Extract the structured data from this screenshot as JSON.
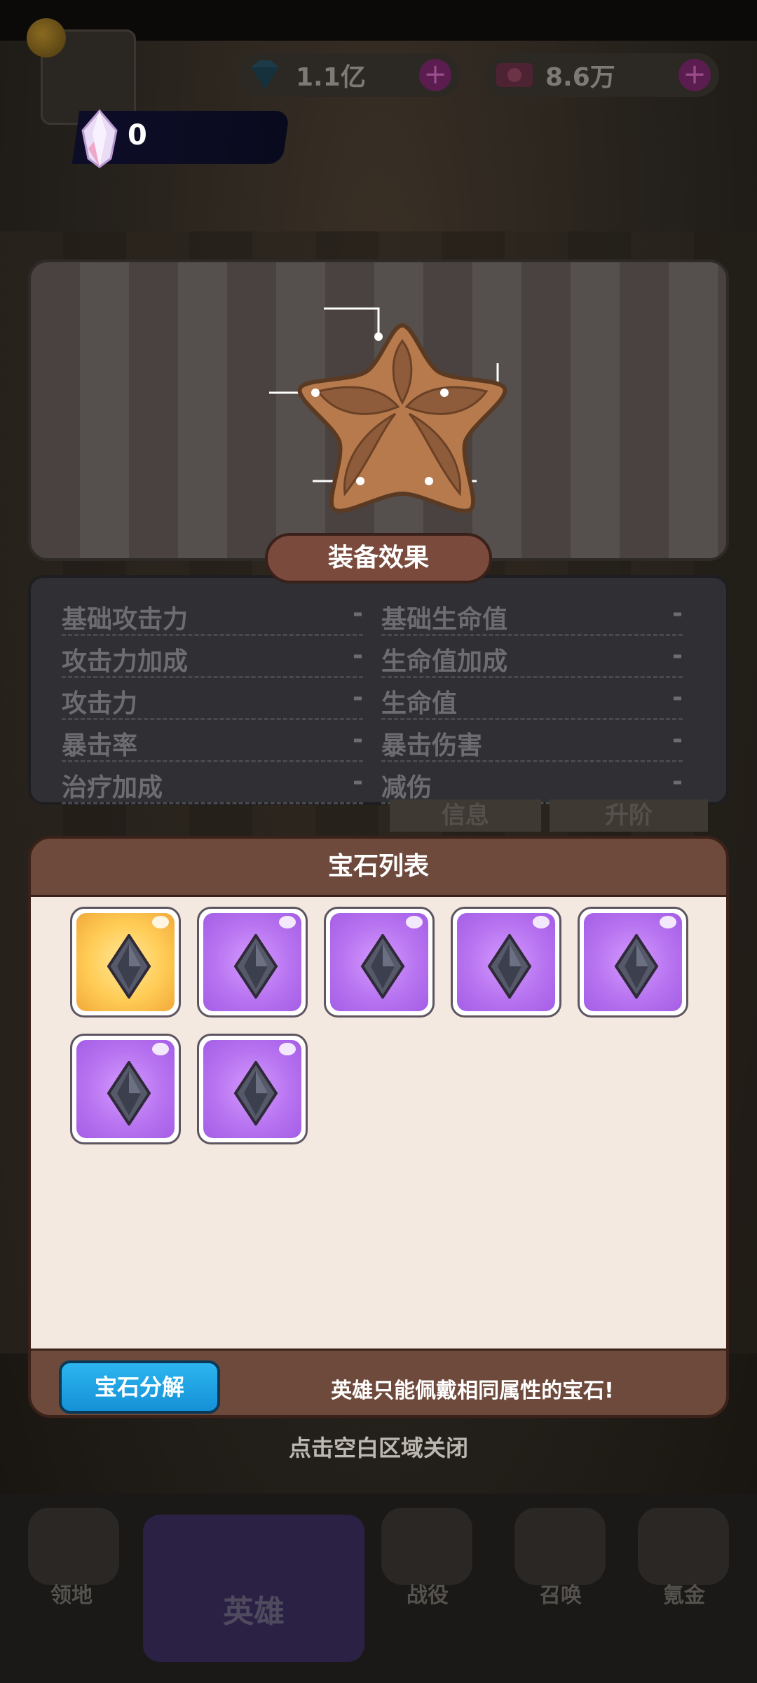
{
  "topbar": {
    "diamonds": "1.1亿",
    "coupons": "8.6万",
    "gem_currency": "0"
  },
  "equip_effect": {
    "title": "装备效果",
    "stats": [
      {
        "label": "基础攻击力",
        "value": "-"
      },
      {
        "label": "基础生命值",
        "value": "-"
      },
      {
        "label": "攻击力加成",
        "value": "-"
      },
      {
        "label": "生命值加成",
        "value": "-"
      },
      {
        "label": "攻击力",
        "value": "-"
      },
      {
        "label": "生命值",
        "value": "-"
      },
      {
        "label": "暴击率",
        "value": "-"
      },
      {
        "label": "暴击伤害",
        "value": "-"
      },
      {
        "label": "治疗加成",
        "value": "-"
      },
      {
        "label": "减伤",
        "value": "-"
      }
    ]
  },
  "background_tabs": {
    "info": "信息",
    "ascend": "升阶"
  },
  "gem_list": {
    "title": "宝石列表",
    "gems": [
      {
        "rarity": "gold",
        "color": "#ffcc55"
      },
      {
        "rarity": "purple",
        "color": "#b773f0"
      },
      {
        "rarity": "purple",
        "color": "#b773f0"
      },
      {
        "rarity": "purple",
        "color": "#b773f0"
      },
      {
        "rarity": "purple",
        "color": "#b773f0"
      },
      {
        "rarity": "purple",
        "color": "#b773f0"
      },
      {
        "rarity": "purple",
        "color": "#b773f0"
      }
    ],
    "decompose_button": "宝石分解",
    "hint": "英雄只能佩戴相同属性的宝石!"
  },
  "close_hint": "点击空白区域关闭",
  "bottom_nav": {
    "territory": "领地",
    "hero": "英雄",
    "battle": "战役",
    "summon": "召唤",
    "recharge": "氪金"
  }
}
